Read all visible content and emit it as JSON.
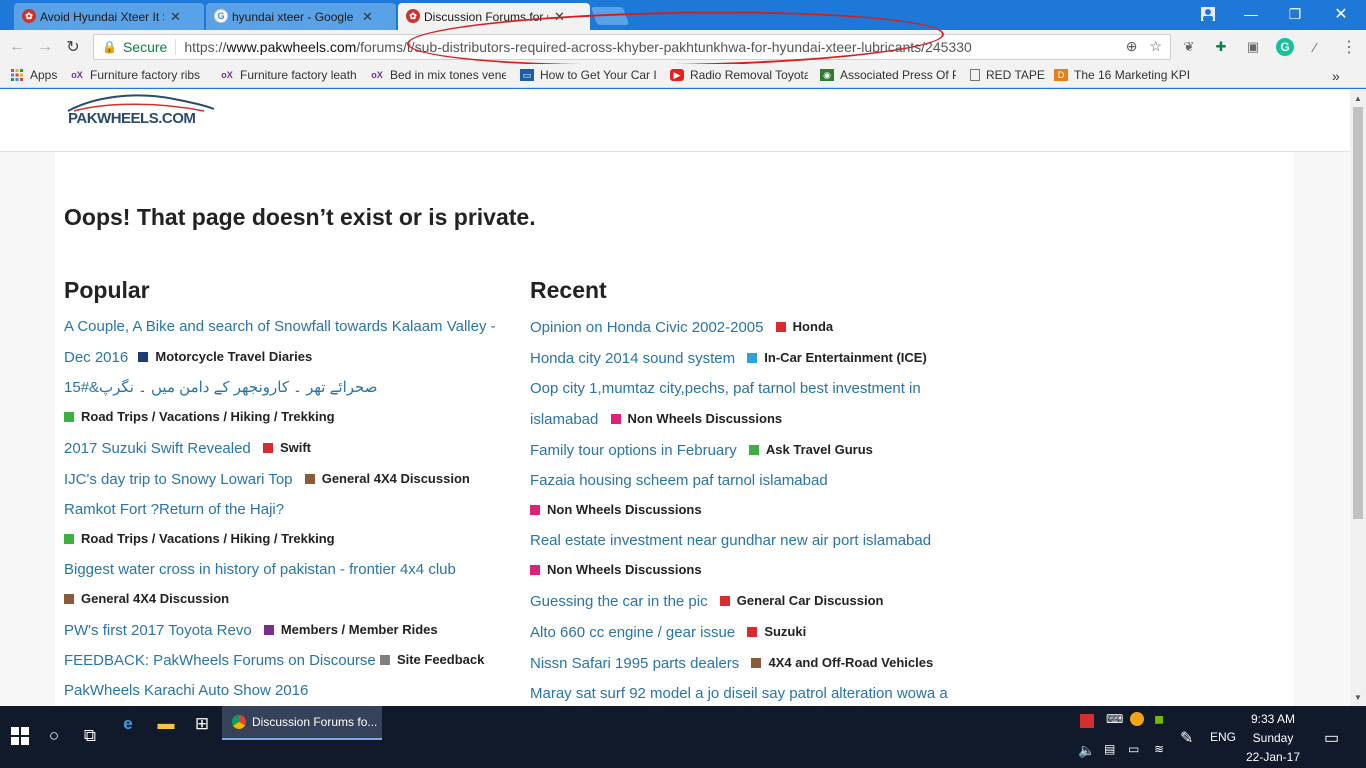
{
  "browser": {
    "tabs": [
      {
        "label": "Avoid Hyundai Xteer It S",
        "favicon_color": "#d32f2f",
        "active": false
      },
      {
        "label": "hyundai xteer - Google S",
        "favicon_color": "#4285f4",
        "active": false
      },
      {
        "label": "Discussion Forums for Ca",
        "favicon_color": "#d32f2f",
        "active": true
      }
    ],
    "tab_close": "✕",
    "secure_label": "Secure",
    "url_scheme": "https://",
    "url_host": "www.pakwheels.com",
    "url_path": "/forums/t/sub-distributors-required-across-khyber-pakhtunkhwa-for-hyundai-xteer-lubricants/245330",
    "annotation_color": "#d51f1f"
  },
  "bookmarks": [
    {
      "label": "Apps",
      "icon": "apps-grid-icon"
    },
    {
      "label": "Furniture factory ribs",
      "icon": "olx-icon"
    },
    {
      "label": "Furniture factory leath",
      "icon": "olx-icon"
    },
    {
      "label": "Bed in mix tones vene",
      "icon": "olx-icon"
    },
    {
      "label": "How to Get Your Car I",
      "icon": "site-icon"
    },
    {
      "label": "Radio Removal Toyota",
      "icon": "youtube-icon"
    },
    {
      "label": "Associated Press Of P",
      "icon": "site-icon"
    },
    {
      "label": "RED TAPE",
      "icon": "page-icon"
    },
    {
      "label": "The 16 Marketing KPI",
      "icon": "site-icon"
    }
  ],
  "bookmarks_overflow": "»",
  "site": {
    "logo_text": "PAKWHEELS.COM",
    "heading": "Oops! That page doesn’t exist or is private.",
    "popular_title": "Popular",
    "recent_title": "Recent",
    "popular": [
      {
        "title": "A Couple, A Bike and search of Snowfall towards Kalaam Valley - Dec 2016",
        "category": "Motorcycle Travel Diaries",
        "color": "#1f3b7a"
      },
      {
        "title": "صحرائے تھر ۔ کارونجھر کے دامن میں ۔ نگرپ&#15",
        "category": "Road Trips / Vacations / Hiking / Trekking",
        "color": "#3cb043"
      },
      {
        "title": "2017 Suzuki Swift Revealed",
        "category": "Swift",
        "color": "#d92b2b"
      },
      {
        "title": "IJC's day trip to Snowy Lowari Top",
        "category": "General 4X4 Discussion",
        "color": "#8a5a3b"
      },
      {
        "title": "Ramkot Fort ?Return of the Haji?",
        "category": "Road Trips / Vacations / Hiking / Trekking",
        "color": "#3cb043"
      },
      {
        "title": "Biggest water cross in history of pakistan - frontier 4x4 club",
        "category": "General 4X4 Discussion",
        "color": "#8a5a3b"
      },
      {
        "title": "PW's first 2017 Toyota Revo",
        "category": "Members / Member Rides",
        "color": "#7b2d8e"
      },
      {
        "title": "FEEDBACK: PakWheels Forums on Discourse",
        "category": "Site Feedback",
        "color": "#808080"
      },
      {
        "title": "PakWheels Karachi Auto Show 2016",
        "category": "",
        "color": ""
      }
    ],
    "recent": [
      {
        "title": "Opinion on Honda Civic 2002-2005",
        "category": "Honda",
        "color": "#d92b2b"
      },
      {
        "title": "Honda city 2014 sound system",
        "category": "In-Car Entertainment (ICE)",
        "color": "#2aa3d9"
      },
      {
        "title": "Oop city 1,mumtaz city,pechs, paf tarnol best investment in islamabad",
        "category": "Non Wheels Discussions",
        "color": "#e0217a"
      },
      {
        "title": "Family tour options in February",
        "category": "Ask Travel Gurus",
        "color": "#3cb043"
      },
      {
        "title": "Fazaia housing scheem paf tarnol islamabad",
        "category": "Non Wheels Discussions",
        "color": "#e0217a"
      },
      {
        "title": "Real estate investment near gundhar new air port islamabad",
        "category": "Non Wheels Discussions",
        "color": "#e0217a"
      },
      {
        "title": "Guessing the car in the pic",
        "category": "General Car Discussion",
        "color": "#d92b2b"
      },
      {
        "title": "Alto 660 cc engine / gear issue",
        "category": "Suzuki",
        "color": "#d92b2b"
      },
      {
        "title": "Nissn Safari 1995 parts dealers",
        "category": "4X4 and Off-Road Vehicles",
        "color": "#8a5a3b"
      },
      {
        "title": "Maray sat surf 92 model a jo diseil say patrol alteration wowa a",
        "category": "",
        "color": ""
      }
    ]
  },
  "taskbar": {
    "active_app": "Discussion Forums fo...",
    "lang": "ENG",
    "time": "9:33 AM",
    "day": "Sunday",
    "date": "22-Jan-17"
  }
}
